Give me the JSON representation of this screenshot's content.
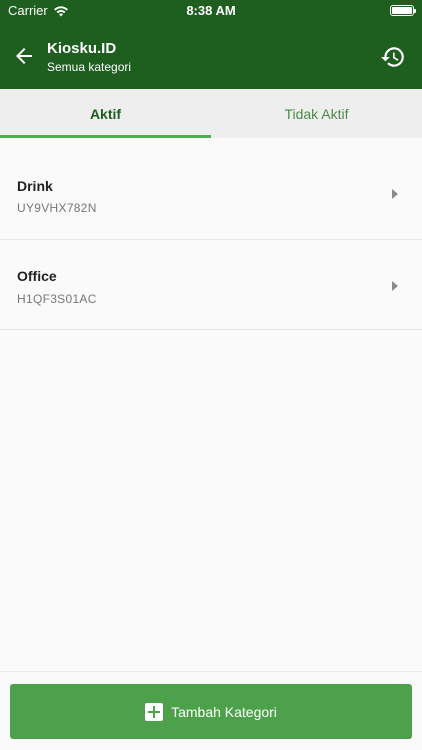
{
  "status_bar": {
    "carrier": "Carrier",
    "time": "8:38 AM"
  },
  "header": {
    "title": "Kiosku.ID",
    "subtitle": "Semua kategori"
  },
  "tabs": [
    {
      "label": "Aktif",
      "active": true
    },
    {
      "label": "Tidak Aktif",
      "active": false
    }
  ],
  "categories": [
    {
      "name": "Drink",
      "code": "UY9VHX782N"
    },
    {
      "name": "Office",
      "code": "H1QF3S01AC"
    }
  ],
  "footer": {
    "add_label": "Tambah Kategori"
  },
  "icons": {
    "back": "arrow-left-icon",
    "history": "history-icon",
    "chevron": "chevron-right-icon",
    "add": "plus-box-icon"
  },
  "colors": {
    "header": "#1e5e1f",
    "tab_indicator": "#4caf50",
    "button": "#4ca14a"
  }
}
